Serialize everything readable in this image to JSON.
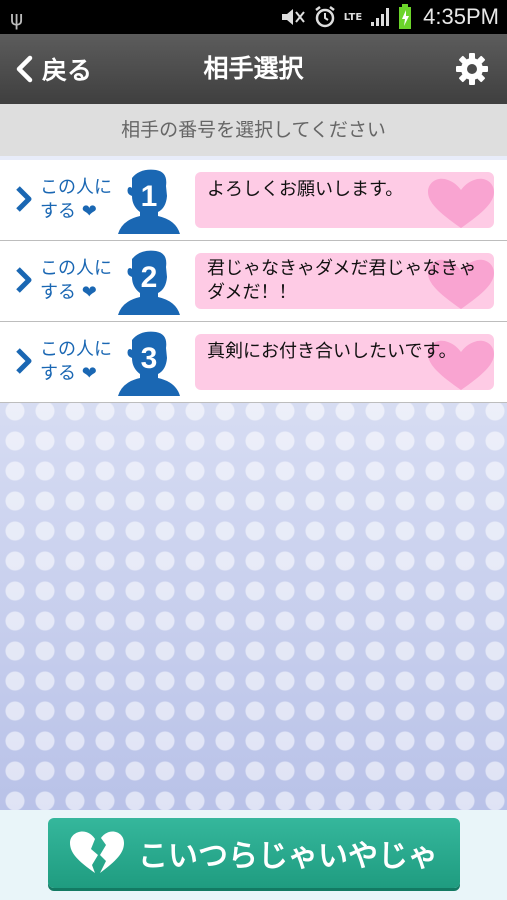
{
  "status_bar": {
    "time": "4:35PM",
    "network": "LTE"
  },
  "header": {
    "back_label": "戻る",
    "title": "相手選択"
  },
  "instruction": "相手の番号を選択してください",
  "partners": [
    {
      "number": "1",
      "choose_line1": "この人に",
      "choose_line2": "する",
      "message": "よろしくお願いします。"
    },
    {
      "number": "2",
      "choose_line1": "この人に",
      "choose_line2": "する",
      "message": "君じゃなきゃダメだ君じゃなきゃダメだ！！"
    },
    {
      "number": "3",
      "choose_line1": "この人に",
      "choose_line2": "する",
      "message": "真剣にお付き合いしたいです。"
    }
  ],
  "footer": {
    "reject_label": "こいつらじゃいやじゃ"
  },
  "colors": {
    "header": "#4a4a4a",
    "accent_blue": "#1a67b3",
    "bubble_pink": "#fecbe5",
    "button_green": "#2aa98e"
  },
  "icons": {
    "back": "chevron-left-icon",
    "settings": "gear-icon",
    "row": "chevron-right-icon",
    "avatar": "person-silhouette-icon",
    "broken_heart": "broken-heart-icon"
  }
}
